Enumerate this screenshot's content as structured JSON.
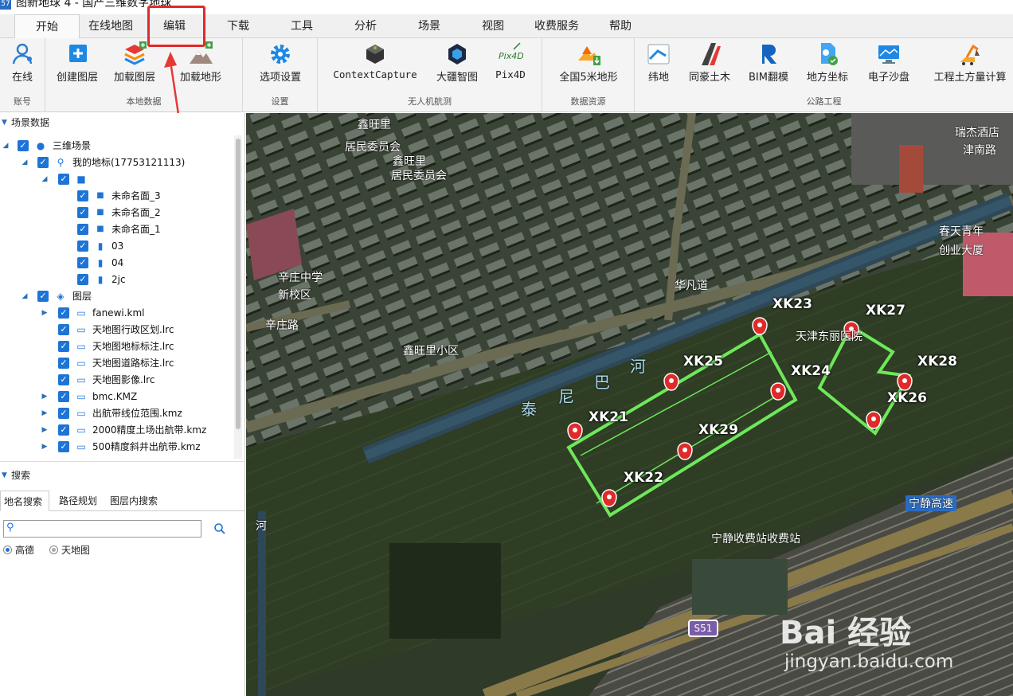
{
  "window": {
    "title": "图新地球 4 - 国产三维数字地球",
    "logo_text": "57"
  },
  "menu": {
    "items": [
      "开始",
      "在线地图",
      "编辑",
      "下载",
      "工具",
      "分析",
      "场景",
      "视图",
      "收费服务",
      "帮助"
    ],
    "active": "开始",
    "highlighted": "编辑"
  },
  "ribbon": {
    "groups": {
      "account": {
        "label": "账号",
        "online": "在线"
      },
      "local": {
        "label": "本地数据",
        "create_layer": "创建图层",
        "load_layer": "加载图层",
        "load_terrain": "加载地形"
      },
      "settings": {
        "label": "设置",
        "options": "选项设置"
      },
      "uav": {
        "label": "无人机航测",
        "context_capture": "ContextCapture",
        "dajiang": "大疆智图",
        "pix4d": "Pix4D"
      },
      "data_resources": {
        "label": "数据资源",
        "terrain5m": "全国5米地形"
      },
      "highway": {
        "label": "公路工程",
        "weidi": "纬地",
        "tonghao": "同豪土木",
        "bim": "BIM翻模",
        "local_coord": "地方坐标",
        "sandbox": "电子沙盘",
        "earthwork": "工程土方量计算"
      }
    }
  },
  "scene_panel": {
    "header": "场景数据",
    "tree": {
      "root": "三维场景",
      "my_places": "我的地标(17753121113)",
      "items": [
        "未命名面_3",
        "未命名面_2",
        "未命名面_1",
        "03",
        "04",
        "2jc"
      ],
      "layers_label": "图层",
      "layers": [
        "fanewi.kml",
        "天地图行政区划.lrc",
        "天地图地标标注.lrc",
        "天地图道路标注.lrc",
        "天地图影像.lrc",
        "bmc.KMZ",
        "出航带线位范围.kmz",
        "2000精度土场出航带.kmz",
        "500精度斜井出航带.kmz"
      ]
    }
  },
  "search_panel": {
    "header": "搜索",
    "tabs": [
      "地名搜索",
      "路径规划",
      "图层内搜索"
    ],
    "active_tab": "地名搜索",
    "input_value": "",
    "providers": [
      "高德",
      "天地图"
    ],
    "selected_provider": "高德"
  },
  "map": {
    "point_labels": [
      "XK21",
      "XK22",
      "XK23",
      "XK24",
      "XK25",
      "XK26",
      "XK27",
      "XK28",
      "XK29"
    ],
    "place_labels": [
      "鑫旺里",
      "居民委员会",
      "鑫旺里",
      "居民委员会",
      "辛庄中学",
      "新校区",
      "鑫旺里小区",
      "天津东丽医院",
      "春天青年",
      "创业大厦",
      "瑞杰酒店",
      "津南路"
    ],
    "road_labels": [
      "辛庄路",
      "华凡道",
      "宁静高速",
      "宁静收费站收费站",
      "河"
    ],
    "river_labels": [
      "泰",
      "尼",
      "巴",
      "河"
    ],
    "shield": "S51",
    "watermark": {
      "brand": "Bai  经验",
      "url": "jingyan.baidu.com"
    },
    "colors": {
      "polygon": "#6ee85a",
      "marker": "#e02a2a"
    }
  }
}
